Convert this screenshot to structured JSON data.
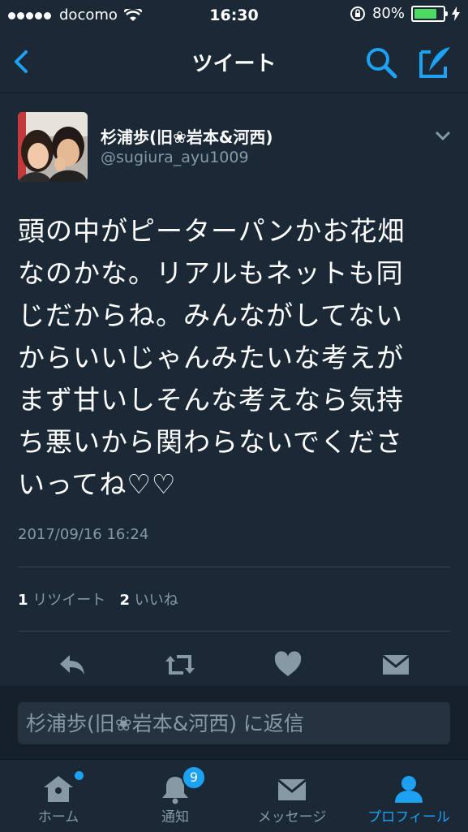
{
  "status": {
    "carrier": "docomo",
    "time": "16:30",
    "battery": "80%"
  },
  "nav": {
    "title": "ツイート"
  },
  "tweet": {
    "display_name": "杉浦歩(旧❀岩本&河西)",
    "handle": "@sugiura_ayu1009",
    "text_lines": [
      "頭の中がピーターパンかお花畑",
      "なのかな。リアルもネットも同",
      "じだからね。みんながしてない",
      "からいいじゃんみたいな考えが",
      "まず甘いしそんな考えなら気持",
      "ち悪いから関わらないでくださ",
      "いってね♡♡"
    ],
    "timestamp": "2017/09/16 16:24",
    "retweet_count": "1",
    "retweet_label": "リツイート",
    "like_count": "2",
    "like_label": "いいね"
  },
  "reply": {
    "placeholder": "杉浦歩(旧❀岩本&河西) に返信"
  },
  "tabs": [
    {
      "label": "ホーム",
      "icon": "home-icon"
    },
    {
      "label": "通知",
      "icon": "bell-icon",
      "badge": "9"
    },
    {
      "label": "メッセージ",
      "icon": "mail-icon"
    },
    {
      "label": "プロフィール",
      "icon": "person-icon"
    }
  ],
  "colors": {
    "accent": "#1da1f2",
    "background": "#15202b",
    "panel": "#1b2836",
    "secondary_text": "#8899a6",
    "battery": "#4cd964"
  }
}
